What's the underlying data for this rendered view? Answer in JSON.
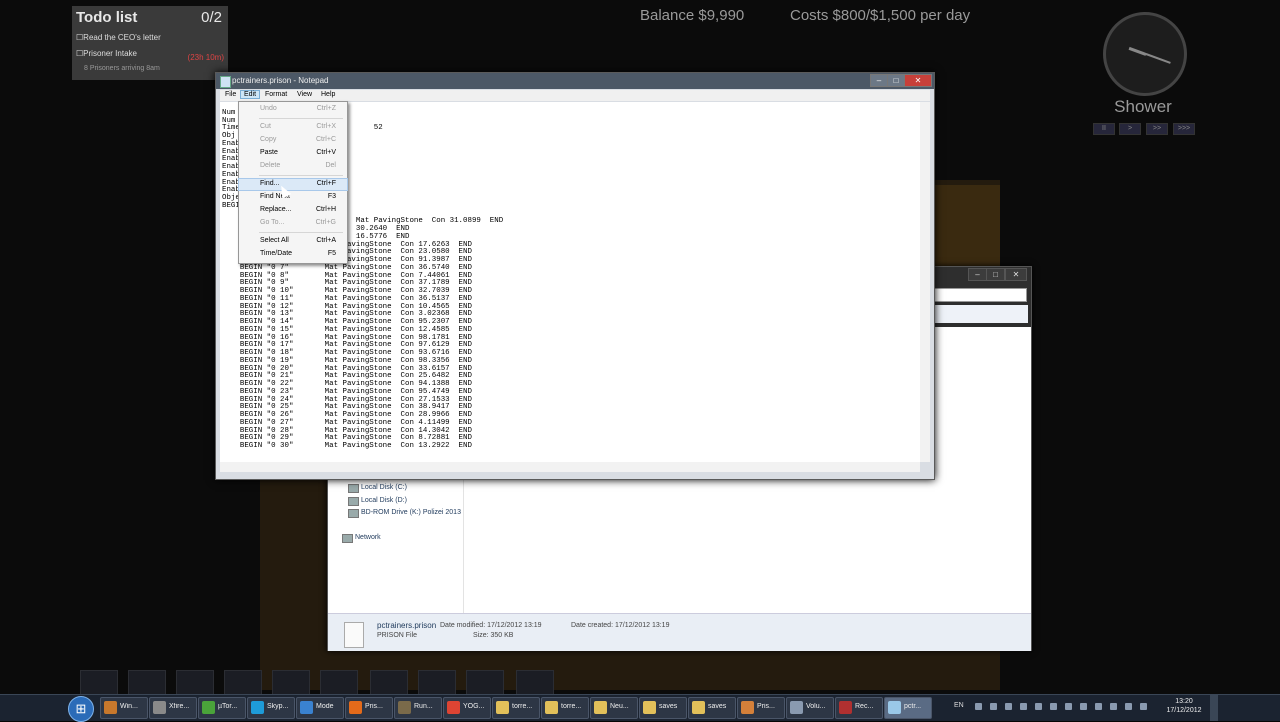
{
  "game": {
    "todo_title": "Todo list",
    "todo_count": "0/2",
    "todo_items": [
      "Read the CEO's letter",
      "Prisoner Intake"
    ],
    "intake_timer": "(23h 10m)",
    "intake_sub": "8 Prisoners arriving 8am",
    "balance": "Balance $9,990",
    "costs": "Costs $800/$1,500 per day",
    "schedule_label": "Shower",
    "speed_buttons": [
      "II",
      ">",
      ">>",
      ">>>"
    ]
  },
  "notepad": {
    "title": "pctrainers.prison - Notepad",
    "menu": [
      "File",
      "Edit",
      "Format",
      "View",
      "Help"
    ],
    "controls": {
      "minimize": "–",
      "maximize": "□",
      "close": "✕"
    },
    "text_lines": [
      "",
      "Num",
      "Num",
      "Time                              52",
      "Obj",
      "Enab",
      "Enab",
      "Enab",
      "Enab",
      "Enab",
      "Enab",
      "Enab",
      "Obje",
      "BEGI",
      "",
      "                              Mat PavingStone  Con 31.0899  END",
      "                              30.2640  END",
      "                              16.5776  END",
      "    BEGIN \"0 4\"        Mat PavingStone  Con 17.6263  END",
      "    BEGIN \"0 5\"        Mat PavingStone  Con 23.0580  END",
      "    BEGIN \"0 6\"        Mat PavingStone  Con 91.3987  END",
      "    BEGIN \"0 7\"        Mat PavingStone  Con 36.5740  END",
      "    BEGIN \"0 8\"        Mat PavingStone  Con 7.44061  END",
      "    BEGIN \"0 9\"        Mat PavingStone  Con 37.1789  END",
      "    BEGIN \"0 10\"       Mat PavingStone  Con 32.7039  END",
      "    BEGIN \"0 11\"       Mat PavingStone  Con 36.5137  END",
      "    BEGIN \"0 12\"       Mat PavingStone  Con 10.4565  END",
      "    BEGIN \"0 13\"       Mat PavingStone  Con 3.02368  END",
      "    BEGIN \"0 14\"       Mat PavingStone  Con 95.2307  END",
      "    BEGIN \"0 15\"       Mat PavingStone  Con 12.4585  END",
      "    BEGIN \"0 16\"       Mat PavingStone  Con 98.1781  END",
      "    BEGIN \"0 17\"       Mat PavingStone  Con 97.6129  END",
      "    BEGIN \"0 18\"       Mat PavingStone  Con 93.6716  END",
      "    BEGIN \"0 19\"       Mat PavingStone  Con 98.3356  END",
      "    BEGIN \"0 20\"       Mat PavingStone  Con 33.6157  END",
      "    BEGIN \"0 21\"       Mat PavingStone  Con 25.6482  END",
      "    BEGIN \"0 22\"       Mat PavingStone  Con 94.1388  END",
      "    BEGIN \"0 23\"       Mat PavingStone  Con 95.4749  END",
      "    BEGIN \"0 24\"       Mat PavingStone  Con 27.1533  END",
      "    BEGIN \"0 25\"       Mat PavingStone  Con 38.9417  END",
      "    BEGIN \"0 26\"       Mat PavingStone  Con 28.9966  END",
      "    BEGIN \"0 27\"       Mat PavingStone  Con 4.11499  END",
      "    BEGIN \"0 28\"       Mat PavingStone  Con 14.3042  END",
      "    BEGIN \"0 29\"       Mat PavingStone  Con 8.72881  END",
      "    BEGIN \"0 30\"       Mat PavingStone  Con 13.2922  END"
    ]
  },
  "edit_menu": {
    "items": [
      {
        "label": "Undo",
        "shortcut": "Ctrl+Z",
        "enabled": false
      },
      {
        "label": "Cut",
        "shortcut": "Ctrl+X",
        "enabled": false
      },
      {
        "label": "Copy",
        "shortcut": "Ctrl+C",
        "enabled": false
      },
      {
        "label": "Paste",
        "shortcut": "Ctrl+V",
        "enabled": true
      },
      {
        "label": "Delete",
        "shortcut": "Del",
        "enabled": false
      },
      {
        "label": "Find...",
        "shortcut": "Ctrl+F",
        "enabled": true,
        "hover": true
      },
      {
        "label": "Find Next",
        "shortcut": "F3",
        "enabled": true
      },
      {
        "label": "Replace...",
        "shortcut": "Ctrl+H",
        "enabled": true
      },
      {
        "label": "Go To...",
        "shortcut": "Ctrl+G",
        "enabled": false
      },
      {
        "label": "Select All",
        "shortcut": "Ctrl+A",
        "enabled": true
      },
      {
        "label": "Time/Date",
        "shortcut": "F5",
        "enabled": true
      }
    ]
  },
  "explorer": {
    "nav": [
      "Local Disk (C:)",
      "Local Disk (D:)",
      "BD-ROM Drive (K:) Polizei 2013",
      "Network"
    ],
    "details": {
      "filename": "pctrainers.prison",
      "date_modified": "Date modified: 17/12/2012 13:19",
      "date_created": "Date created: 17/12/2012 13:19",
      "type": "PRISON File",
      "size": "Size: 350 KB"
    }
  },
  "taskbar": {
    "items": [
      {
        "label": "Win...",
        "color": "#c8782c"
      },
      {
        "label": "Xfire...",
        "color": "#8a8a8a"
      },
      {
        "label": "µTor...",
        "color": "#4aa33a"
      },
      {
        "label": "Skyp...",
        "color": "#1e9bd8"
      },
      {
        "label": "Mode",
        "color": "#3a82d0"
      },
      {
        "label": "Pris...",
        "color": "#e46a1a"
      },
      {
        "label": "Run...",
        "color": "#7a6a4a"
      },
      {
        "label": "YOG...",
        "color": "#dd4433"
      },
      {
        "label": "torre...",
        "color": "#e2c05a"
      },
      {
        "label": "torre...",
        "color": "#e2c05a"
      },
      {
        "label": "Neu...",
        "color": "#e2c05a"
      },
      {
        "label": "saves",
        "color": "#e2c05a"
      },
      {
        "label": "saves",
        "color": "#e2c05a"
      },
      {
        "label": "Pris...",
        "color": "#d4803a"
      },
      {
        "label": "Volu...",
        "color": "#8a9ab0"
      },
      {
        "label": "Rec...",
        "color": "#b03030"
      },
      {
        "label": "pctr...",
        "color": "#9ac8e8",
        "active": true
      }
    ],
    "lang": "EN",
    "time": "13:20",
    "date": "17/12/2012"
  }
}
